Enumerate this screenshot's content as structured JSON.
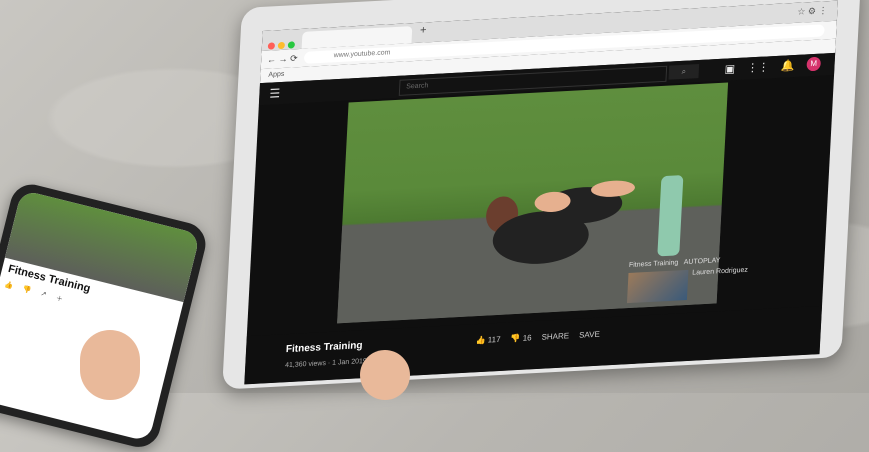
{
  "browser": {
    "address": "www.youtube.com",
    "bookmark": "Apps"
  },
  "youtube": {
    "search_placeholder": "Search",
    "avatar_letter": "M",
    "video": {
      "title": "Fitness Training",
      "meta": "41,360 views · 1 Jan 2019"
    },
    "actions": {
      "like": "117",
      "dislike": "16",
      "share": "SHARE",
      "save": "SAVE"
    },
    "sidebar": {
      "heading": "Fitness Training",
      "autoplay": "AUTOPLAY",
      "item_channel": "Lauren Rodriguez"
    }
  },
  "phone": {
    "title": "Fitness Training"
  }
}
